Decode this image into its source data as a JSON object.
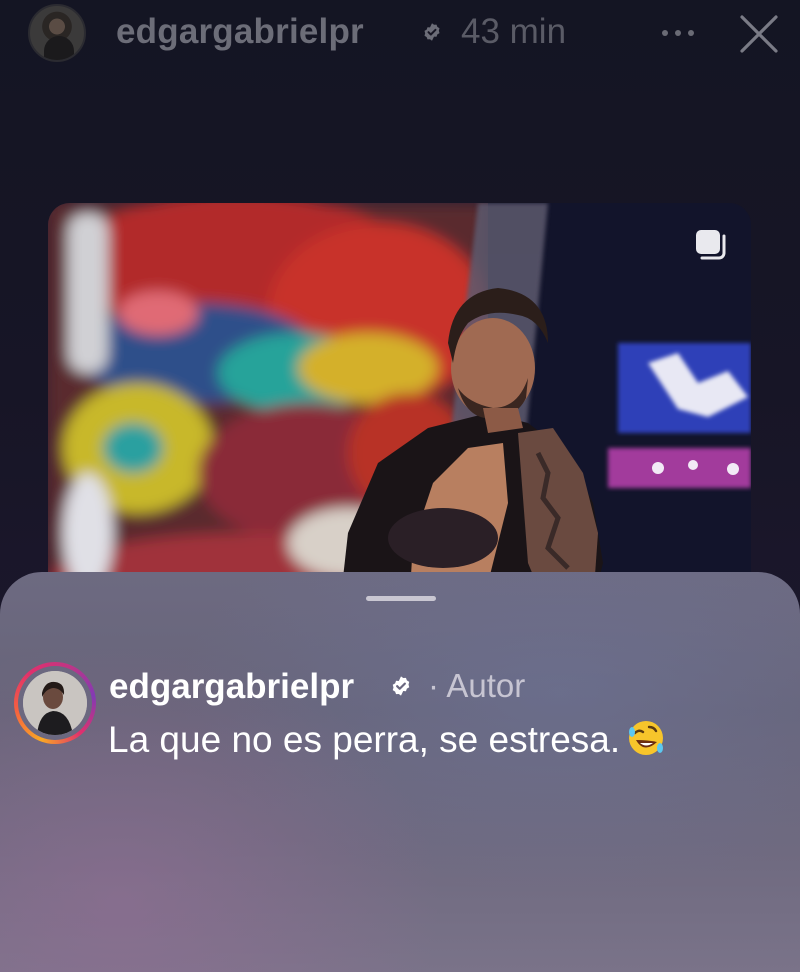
{
  "header": {
    "username": "edgargabrielpr",
    "verified": true,
    "time": "43 min",
    "more_icon": "more-horizontal-icon",
    "close_icon": "close-icon"
  },
  "post": {
    "media": "shared-post-photo",
    "carousel_icon": "carousel-icon"
  },
  "comment_sheet": {
    "comment": {
      "username": "edgargabrielpr",
      "verified": true,
      "author_label": "· Autor",
      "text": "La que no es perra, se estresa.",
      "emoji": "rolling-on-floor-laughing-emoji"
    }
  },
  "colors": {
    "background": "#161523",
    "sheet": "#6d6a81",
    "text_primary": "#ffffff",
    "text_muted": "#c7c5d2",
    "story_ring": [
      "#f9a825",
      "#e1306c",
      "#833ab4"
    ]
  }
}
